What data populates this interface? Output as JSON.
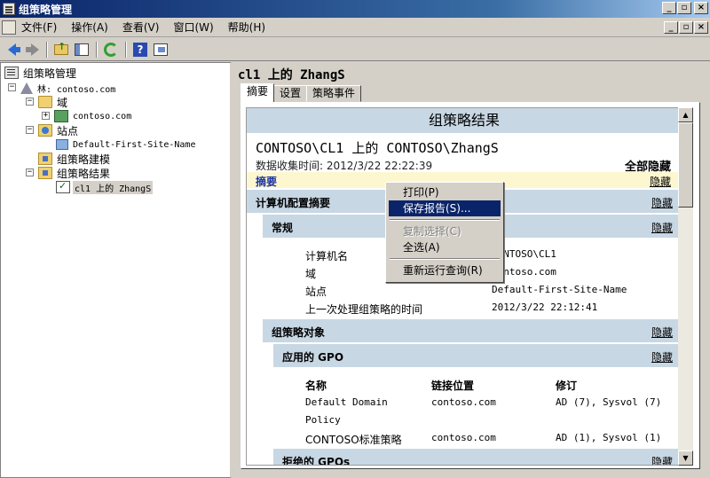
{
  "window": {
    "title": "组策略管理"
  },
  "menu": {
    "items": [
      "文件(F)",
      "操作(A)",
      "查看(V)",
      "窗口(W)",
      "帮助(H)"
    ]
  },
  "toolbar": {
    "icons": [
      "back-arrow",
      "forward-arrow",
      "up-folder",
      "show-hide-tree",
      "refresh",
      "help",
      "console"
    ]
  },
  "tree": {
    "root": "组策略管理",
    "forest": "林: contoso.com",
    "domains": "域",
    "domain": "contoso.com",
    "sites": "站点",
    "site": "Default-First-Site-Name",
    "modeling": "组策略建模",
    "results": "组策略结果",
    "result_item": "cl1 上的 ZhangS"
  },
  "right": {
    "title": "cl1 上的 ZhangS",
    "tabs": [
      "摘要",
      "设置",
      "策略事件"
    ]
  },
  "report": {
    "header": "组策略结果",
    "title": "CONTOSO\\CL1 上的 CONTOSO\\ZhangS",
    "date": "数据收集时间: 2012/3/22 22:22:39",
    "hide_all": "全部隐藏",
    "summary": "摘要",
    "hide": "隐藏",
    "computer_summary": "计算机配置摘要",
    "general": "常规",
    "general_rows": [
      {
        "k": "计算机名",
        "v": "CONTOSO\\CL1"
      },
      {
        "k": "域",
        "v": "contoso.com"
      },
      {
        "k": "站点",
        "v": "Default-First-Site-Name"
      },
      {
        "k": "上一次处理组策略的时间",
        "v": "2012/3/22 22:12:41"
      }
    ],
    "gpo": "组策略对象",
    "applied": "应用的 GPO",
    "cols": [
      "名称",
      "链接位置",
      "修订"
    ],
    "gpo_rows": [
      {
        "name1": "Default Domain",
        "name2": "Policy",
        "link": "contoso.com",
        "rev": "AD (7), Sysvol (7)"
      },
      {
        "name1": "CONTOSO标准策略",
        "link": "contoso.com",
        "rev": "AD (1), Sysvol (1)"
      }
    ],
    "denied": "拒绝的 GPOs"
  },
  "context_menu": {
    "items": [
      "打印(P)",
      "保存报告(S)...",
      "复制选择(C)",
      "全选(A)",
      "重新运行查询(R)"
    ],
    "highlighted": "保存报告(S)...",
    "disabled": "复制选择(C)"
  },
  "colors": {
    "titlebar": "#0a246a",
    "section": "#c8d7e4",
    "summary_bar": "#fdf7d0",
    "link": "#1a34a0"
  }
}
